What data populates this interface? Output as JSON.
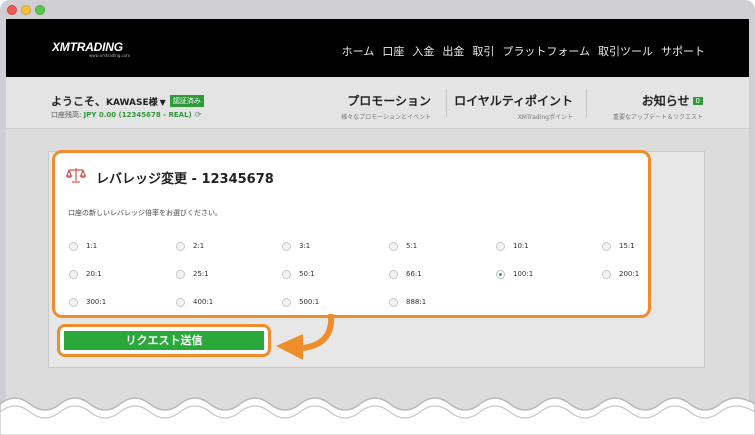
{
  "colors": {
    "accent_orange": "#ee8d2a",
    "brand_green": "#2aa83a",
    "topbar": "#000000"
  },
  "header": {
    "logo": "XMTRADING",
    "logo_sub": "www.xmtrading.com",
    "nav": [
      "ホーム",
      "口座",
      "入金",
      "出金",
      "取引",
      "プラットフォーム",
      "取引ツール",
      "サポート"
    ]
  },
  "account": {
    "welcome": "ようこそ、",
    "username": "KAWASE様",
    "verified_badge": "認証済み",
    "balance_label": "口座残高: ",
    "balance_value": "JPY 0.00 (12345678 - REAL)",
    "promo_title": "プロモーション",
    "promo_sub": "様々なプロモーションとイベント",
    "loyalty_title": "ロイヤルティポイント",
    "loyalty_sub": "XMTradingポイント",
    "notice_title": "お知らせ",
    "notice_count": "0",
    "notice_sub": "重要なアップデート＆リクエスト"
  },
  "dialog": {
    "icon": "scales-icon",
    "title": "レバレッジ変更 - 12345678",
    "description": "口座の新しいレバレッジ倍率をお選びください。",
    "selected": "100:1",
    "options": [
      "1:1",
      "2:1",
      "3:1",
      "5:1",
      "10:1",
      "15:1",
      "20:1",
      "25:1",
      "50:1",
      "66:1",
      "100:1",
      "200:1",
      "300:1",
      "400:1",
      "500:1",
      "888:1"
    ]
  },
  "submit": {
    "label": "リクエスト送信"
  }
}
